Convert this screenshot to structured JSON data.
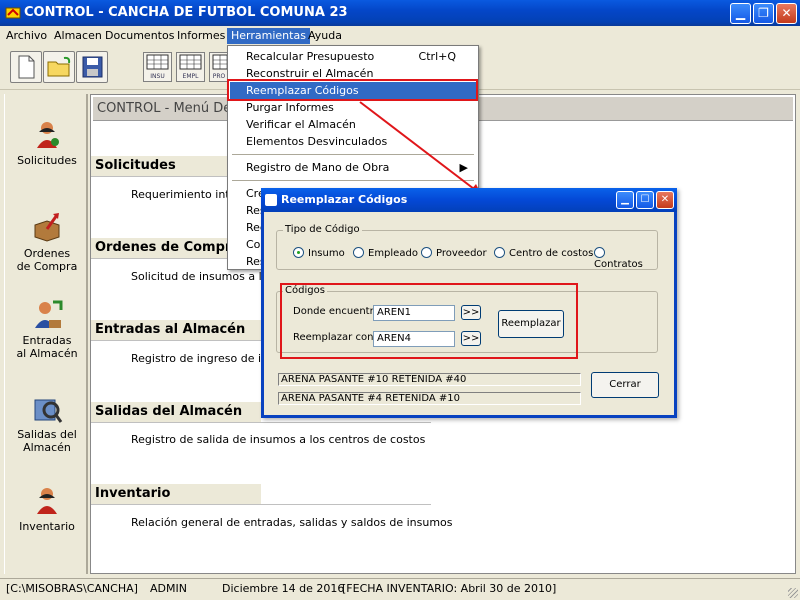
{
  "window": {
    "title": "CONTROL - CANCHA DE FUTBOL COMUNA 23"
  },
  "menubar": [
    "Archivo",
    "Almacen",
    "Documentos",
    "Informes",
    "Herramientas",
    "Ayuda"
  ],
  "toolbar": {
    "small_buttons": [
      "INSU",
      "EMPL",
      "PRO"
    ]
  },
  "sidebar": [
    {
      "label": "Solicitudes",
      "icon": "person-request-icon"
    },
    {
      "label": "Ordenes\nde Compra",
      "icon": "box-arrow-icon"
    },
    {
      "label": "Entradas\nal Almacén",
      "icon": "person-entry-icon"
    },
    {
      "label": "Salidas del\nAlmacén",
      "icon": "exit-icon"
    },
    {
      "label": "Inventario",
      "icon": "person-inventory-icon"
    }
  ],
  "main": {
    "header": "CONTROL - Menú De",
    "sections": [
      {
        "title": "Solicitudes",
        "desc": "Requerimiento intern"
      },
      {
        "title": "Ordenes de Compra",
        "desc": "Solicitud de insumos a los p"
      },
      {
        "title": "Entradas al Almacén",
        "desc": "Registro de ingreso de insum"
      },
      {
        "title": "Salidas del Almacén",
        "desc": "Registro de salida de insumos a los centros de costos"
      },
      {
        "title": "Inventario",
        "desc": "Relación general de entradas, salidas y saldos de insumos"
      }
    ]
  },
  "dropdown": {
    "items": [
      {
        "label": "Recalcular Presupuesto",
        "shortcut": "Ctrl+Q"
      },
      {
        "label": "Reconstruir el Almacén",
        "shortcut": ""
      },
      {
        "label": "Reemplazar Códigos",
        "shortcut": ""
      },
      {
        "label": "Purgar Informes",
        "shortcut": ""
      },
      {
        "label": "Verificar el Almacén",
        "shortcut": ""
      },
      {
        "label": "Elementos Desvinculados",
        "shortcut": ""
      },
      {
        "label": "Registro de Mano de Obra",
        "shortcut": ""
      },
      {
        "label": "Cre",
        "shortcut": ""
      },
      {
        "label": "Res",
        "shortcut": ""
      },
      {
        "label": "Rec",
        "shortcut": ""
      },
      {
        "label": "Cor",
        "shortcut": ""
      },
      {
        "label": "Res",
        "shortcut": ""
      }
    ]
  },
  "dialog": {
    "title": "Reemplazar Códigos",
    "tipo_label": "Tipo de Código",
    "radios": [
      "Insumo",
      "Empleado",
      "Proveedor",
      "Centro de costos",
      "Contratos"
    ],
    "selected_radio": "Insumo",
    "codigos_label": "Códigos",
    "donde_label": "Donde encuentre",
    "donde_value": "AREN1",
    "reemplazar_label": "Reemplazar con",
    "reemplazar_value": "AREN4",
    "browse_label": ">>",
    "reemplazar_button": "Reemplazar",
    "info1": "ARENA PASANTE #10 RETENIDA #40",
    "info2": "ARENA PASANTE #4 RETENIDA #10",
    "cerrar_button": "Cerrar"
  },
  "statusbar": {
    "path": "[C:\\MISOBRAS\\CANCHA]",
    "user": "ADMIN",
    "date": "Diciembre 14 de 2016",
    "inventory": "[FECHA INVENTARIO: Abril 30 de 2010]"
  }
}
